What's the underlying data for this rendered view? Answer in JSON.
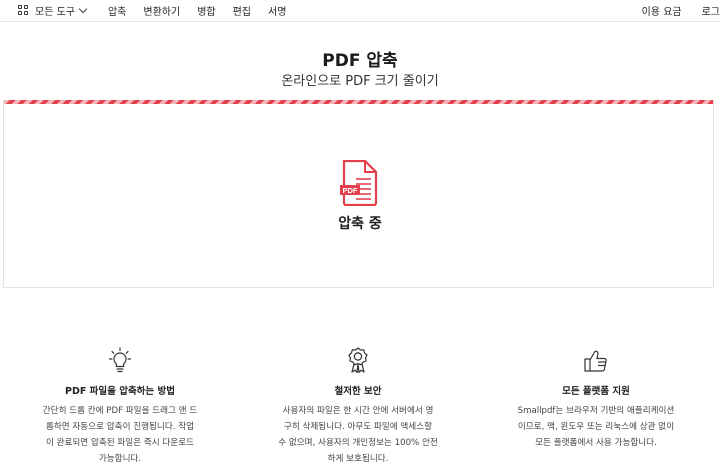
{
  "nav": {
    "all_tools": "모든 도구",
    "links": [
      "압축",
      "변환하기",
      "병합",
      "편집",
      "서명"
    ],
    "pricing": "이용 요금",
    "login": "로그"
  },
  "hero": {
    "title": "PDF 압축",
    "subtitle": "온라인으로 PDF 크기 줄이기"
  },
  "progress": {
    "status": "압축 중",
    "file_badge": "PDF",
    "accent_color": "#e2414c"
  },
  "features": [
    {
      "icon": "lightbulb-icon",
      "title": "PDF 파일을 압축하는 방법",
      "lines": [
        "간단히 드롭 칸에 PDF 파일을 드래그 앤 드",
        "롭하면 자동으로 압축이 진행됩니다. 작업",
        "이 완료되면 압축된 파일은 즉시 다운로드",
        "가능합니다."
      ]
    },
    {
      "icon": "award-icon",
      "title": "철저한 보안",
      "lines": [
        "사용자의 파일은 한 시간 안에 서버에서 영",
        "구히 삭제됩니다. 아무도 파일에 액세스할",
        "수 없으며, 사용자의 개인정보는 100% 안전",
        "하게 보호됩니다."
      ]
    },
    {
      "icon": "thumbs-up-icon",
      "title": "모든 플랫폼 지원",
      "lines": [
        "Smallpdf는 브라우저 기반의 애플리케이션",
        "이므로, 맥, 윈도우 또는 리눅스에 상관 없이",
        "모든 플랫폼에서 사용 가능합니다."
      ]
    }
  ]
}
